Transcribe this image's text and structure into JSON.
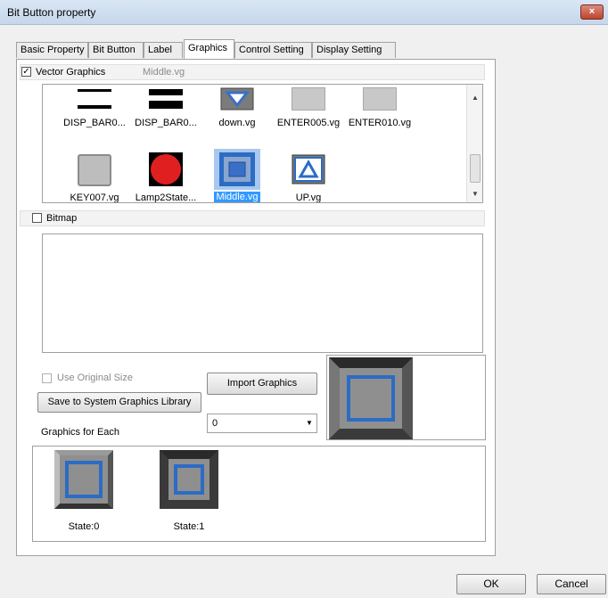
{
  "window": {
    "title": "Bit Button property",
    "close_glyph": "×"
  },
  "tabs": [
    {
      "label": "Basic Property",
      "active": false
    },
    {
      "label": "Bit Button",
      "active": false
    },
    {
      "label": "Label",
      "active": false
    },
    {
      "label": "Graphics",
      "active": true
    },
    {
      "label": "Control Setting",
      "active": false
    },
    {
      "label": "Display Setting",
      "active": false
    }
  ],
  "vector_graphics": {
    "label": "Vector Graphics",
    "checked": true,
    "current_file": "Middle.vg",
    "items": [
      {
        "caption": "DISP_BAR0...",
        "icon": "bar-white-icon"
      },
      {
        "caption": "DISP_BAR0...",
        "icon": "bar-black-icon"
      },
      {
        "caption": "down.vg",
        "icon": "triangle-down-icon"
      },
      {
        "caption": "ENTER005.vg",
        "icon": "gray-square-icon"
      },
      {
        "caption": "ENTER010.vg",
        "icon": "gray-square-icon"
      },
      {
        "caption": "KEY007.vg",
        "icon": "gray-key-icon"
      },
      {
        "caption": "Lamp2State...",
        "icon": "red-lamp-icon"
      },
      {
        "caption": "Middle.vg",
        "icon": "blue-square-icon",
        "selected": true
      },
      {
        "caption": "UP.vg",
        "icon": "triangle-up-icon"
      }
    ]
  },
  "bitmap": {
    "label": "Bitmap",
    "checked": false
  },
  "use_original_size": {
    "label": "Use Original Size",
    "checked": false,
    "enabled": false
  },
  "buttons": {
    "import_graphics": "Import Graphics",
    "save_to_library": "Save to System Graphics Library",
    "ok": "OK",
    "cancel": "Cancel"
  },
  "graphics_for_each": {
    "label": "Graphics for Each",
    "value": "0"
  },
  "states": [
    {
      "label": "State:0"
    },
    {
      "label": "State:1"
    }
  ],
  "colors": {
    "accent_blue": "#3a6fc7",
    "selection": "#3399ff",
    "lamp_red": "#e02020"
  }
}
